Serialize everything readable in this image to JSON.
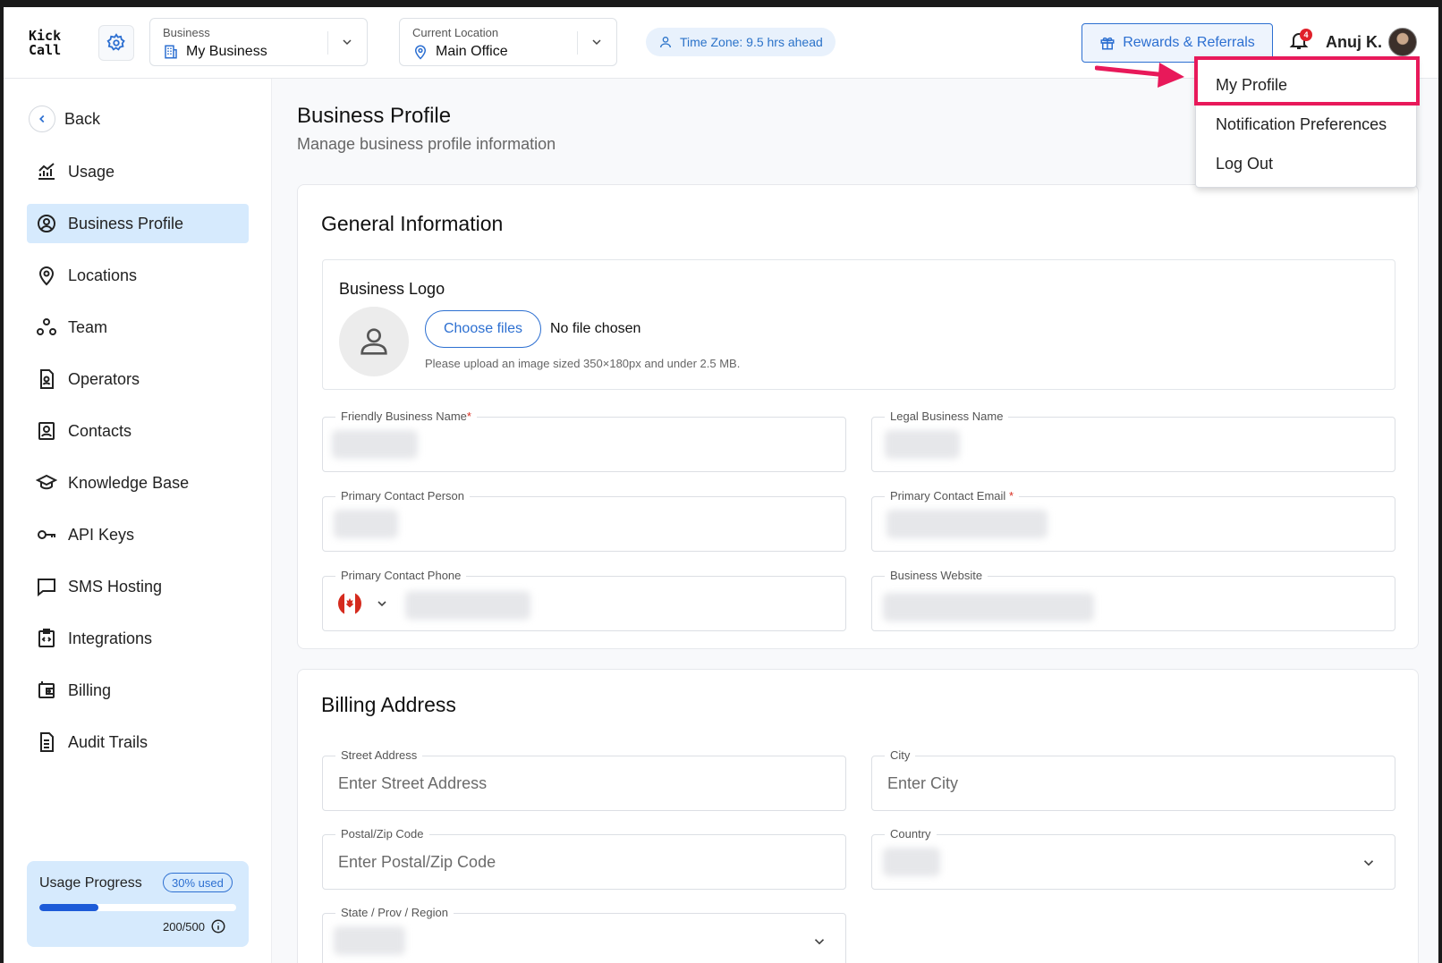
{
  "logo": {
    "line1": "Kick",
    "line2": "Call"
  },
  "business_selector": {
    "label": "Business",
    "value": "My Business"
  },
  "location_selector": {
    "label": "Current Location",
    "value": "Main Office"
  },
  "timezone": {
    "text": "Time Zone: 9.5 hrs ahead"
  },
  "rewards_button": {
    "label": "Rewards & Referrals"
  },
  "notifications": {
    "count": "4"
  },
  "user": {
    "name": "Anuj K."
  },
  "user_menu": {
    "items": [
      "My Profile",
      "Notification Preferences",
      "Log Out"
    ],
    "highlighted": "My Profile"
  },
  "sidebar": {
    "back_label": "Back",
    "items": [
      {
        "label": "Usage",
        "icon": "chart-line-icon"
      },
      {
        "label": "Business Profile",
        "icon": "user-circle-icon",
        "active": true
      },
      {
        "label": "Locations",
        "icon": "map-pin-icon"
      },
      {
        "label": "Team",
        "icon": "team-icon"
      },
      {
        "label": "Operators",
        "icon": "operator-file-icon"
      },
      {
        "label": "Contacts",
        "icon": "contact-card-icon"
      },
      {
        "label": "Knowledge Base",
        "icon": "graduation-cap-icon"
      },
      {
        "label": "API Keys",
        "icon": "key-icon"
      },
      {
        "label": "SMS Hosting",
        "icon": "message-square-icon"
      },
      {
        "label": "Integrations",
        "icon": "code-clipboard-icon"
      },
      {
        "label": "Billing",
        "icon": "wallet-icon"
      },
      {
        "label": "Audit Trails",
        "icon": "document-icon"
      }
    ],
    "usage": {
      "title": "Usage Progress",
      "badge": "30% used",
      "fraction": 0.3,
      "count": "200/500"
    }
  },
  "main": {
    "title": "Business Profile",
    "subtitle": "Manage business profile information",
    "general": {
      "title": "General Information",
      "logo_section": {
        "title": "Business Logo",
        "button": "Choose files",
        "status": "No file chosen",
        "hint": "Please upload an image sized 350×180px and under 2.5 MB."
      },
      "fields": {
        "friendly_name": "Friendly Business Name",
        "legal_name": "Legal Business Name",
        "contact_person": "Primary Contact Person",
        "contact_email": "Primary Contact Email",
        "contact_phone": "Primary Contact Phone",
        "website": "Business Website"
      },
      "required_mark": "*"
    },
    "billing": {
      "title": "Billing Address",
      "street_label": "Street Address",
      "street_placeholder": "Enter Street Address",
      "city_label": "City",
      "city_placeholder": "Enter City",
      "postal_label": "Postal/Zip Code",
      "postal_placeholder": "Enter Postal/Zip Code",
      "country_label": "Country",
      "state_label": "State / Prov / Region"
    }
  },
  "colors": {
    "accent": "#2c6fd1",
    "highlight": "#e8195a",
    "active_bg": "#d6eafd"
  }
}
